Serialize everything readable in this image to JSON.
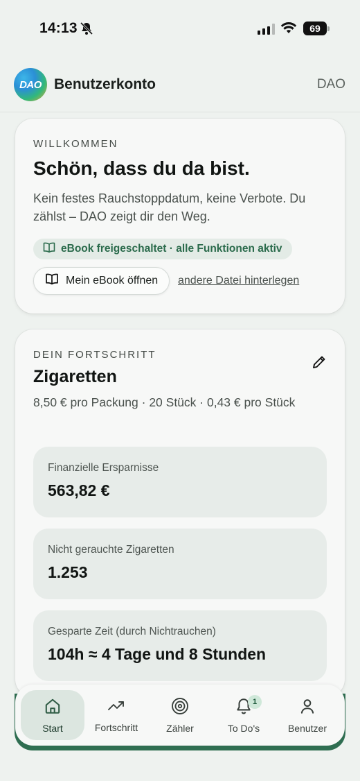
{
  "status": {
    "time": "14:13",
    "battery": "69"
  },
  "header": {
    "title": "Benutzerkonto",
    "logo_text": "DAO",
    "right_label": "DAO"
  },
  "welcome": {
    "eyebrow": "WILLKOMMEN",
    "title": "Schön, dass du da bist.",
    "text": "Kein festes Rauchstoppdatum, keine Verbote. Du zählst – DAO zeigt dir den Weg.",
    "badge": "eBook freigeschaltet · alle Funktionen aktiv",
    "open_button": "Mein eBook öffnen",
    "alt_link": "andere Datei hinterlegen"
  },
  "progress": {
    "eyebrow": "DEIN FORTSCHRITT",
    "title": "Zigaretten",
    "subtitle": "8,50 € pro Packung · 20 Stück · 0,43 € pro Stück",
    "stats": [
      {
        "label": "Finanzielle Ersparnisse",
        "value": "563,82 €"
      },
      {
        "label": "Nicht gerauchte Zigaretten",
        "value": "1.253"
      },
      {
        "label": "Gesparte Zeit (durch Nichtrauchen)",
        "value": "104h ≈ 4 Tage und 8 Stunden"
      }
    ]
  },
  "nav": {
    "items": [
      {
        "label": "Start",
        "icon": "home-icon",
        "active": true
      },
      {
        "label": "Fortschritt",
        "icon": "trending-up-icon"
      },
      {
        "label": "Zähler",
        "icon": "target-icon"
      },
      {
        "label": "To Do's",
        "icon": "bell-icon",
        "badge": "1"
      },
      {
        "label": "Benutzer",
        "icon": "user-icon"
      }
    ]
  },
  "colors": {
    "accent": "#2f6e51",
    "background": "#eef2ef",
    "card": "#f7f8f7",
    "stat_bg": "#e7ece9"
  }
}
